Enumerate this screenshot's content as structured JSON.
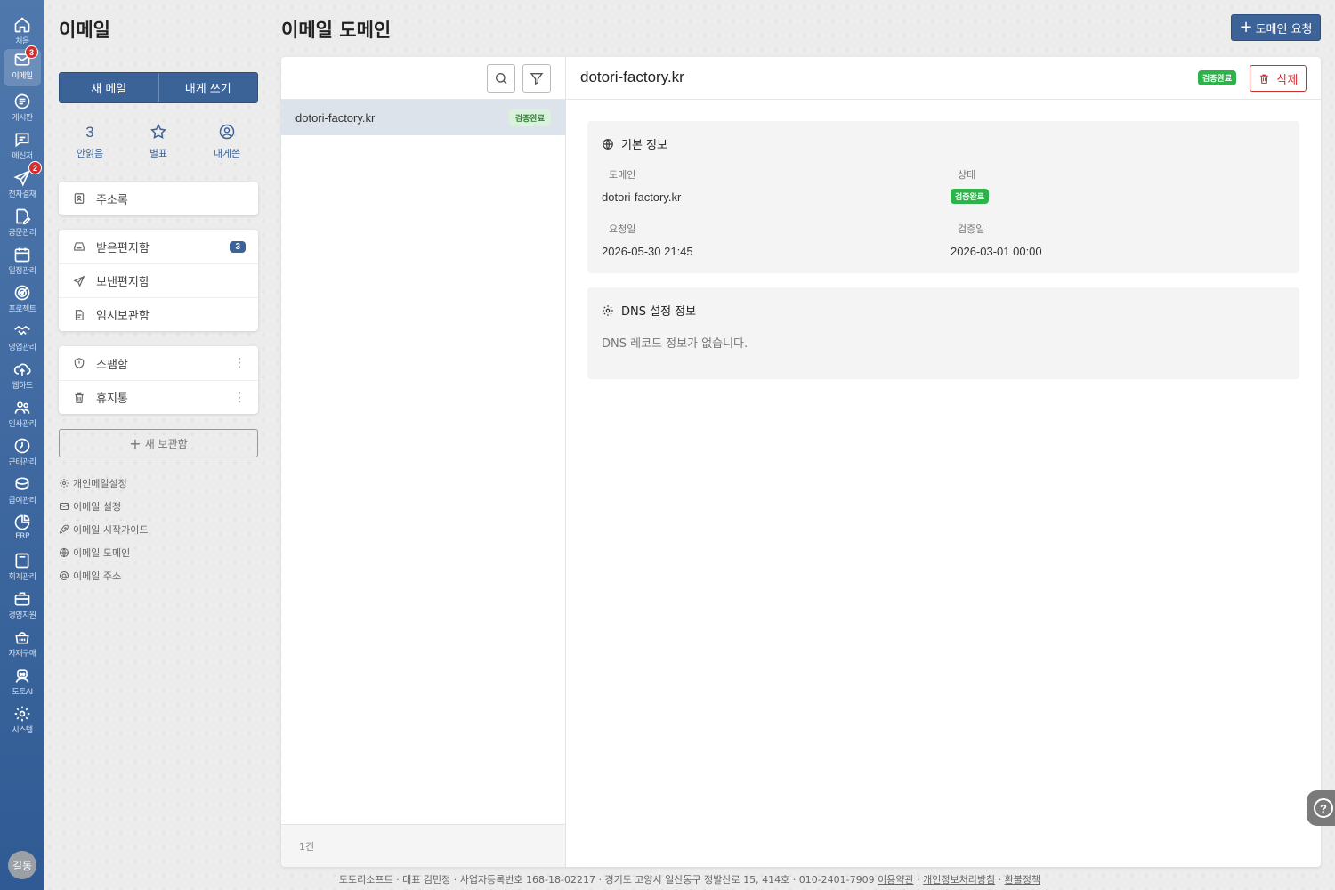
{
  "rail": {
    "items": [
      {
        "label": "처음",
        "icon": "home-icon"
      },
      {
        "label": "이메일",
        "icon": "mail-icon",
        "badge": "3"
      },
      {
        "label": "게시판",
        "icon": "board-icon"
      },
      {
        "label": "메신저",
        "icon": "chat-icon"
      },
      {
        "label": "전자결재",
        "icon": "send-icon",
        "badge": "2"
      },
      {
        "label": "공문관리",
        "icon": "document-edit-icon"
      },
      {
        "label": "일정관리",
        "icon": "calendar-icon"
      },
      {
        "label": "프로젝트",
        "icon": "target-icon"
      },
      {
        "label": "영업관리",
        "icon": "handshake-icon"
      },
      {
        "label": "웹하드",
        "icon": "cloud-upload-icon"
      },
      {
        "label": "인사관리",
        "icon": "people-icon"
      },
      {
        "label": "근태관리",
        "icon": "clock-icon"
      },
      {
        "label": "급여관리",
        "icon": "coins-icon"
      },
      {
        "label": "ERP",
        "icon": "pie-chart-icon"
      },
      {
        "label": "회계관리",
        "icon": "calculator-icon"
      },
      {
        "label": "경영지원",
        "icon": "briefcase-icon"
      },
      {
        "label": "자재구매",
        "icon": "basket-icon"
      },
      {
        "label": "도토AI",
        "icon": "robot-icon"
      },
      {
        "label": "시스템",
        "icon": "gear-icon"
      }
    ],
    "avatar": "길동"
  },
  "sidebar": {
    "title": "이메일",
    "new_mail": "새 메일",
    "self_mail": "내게 쓰기",
    "quick": {
      "unread_count": "3",
      "unread_label": "안읽음",
      "star_label": "별표",
      "self_label": "내게쓴"
    },
    "address_book": "주소록",
    "folders": [
      {
        "label": "받은편지함",
        "count": "3"
      },
      {
        "label": "보낸편지함"
      },
      {
        "label": "임시보관함"
      }
    ],
    "special": [
      {
        "label": "스팸함"
      },
      {
        "label": "휴지통"
      }
    ],
    "new_box": "새 보관함",
    "links": [
      {
        "label": "개인메일설정",
        "icon": "gear-icon"
      },
      {
        "label": "이메일 설정",
        "icon": "mail-icon"
      },
      {
        "label": "이메일 시작가이드",
        "icon": "rocket-icon"
      },
      {
        "label": "이메일 도메인",
        "icon": "globe-icon"
      },
      {
        "label": "이메일 주소",
        "icon": "at-icon"
      }
    ]
  },
  "main": {
    "title": "이메일 도메인",
    "request_button": "도메인 요청",
    "list": {
      "items": [
        {
          "domain": "dotori-factory.kr",
          "status": "검증완료"
        }
      ],
      "count_text": "1건"
    },
    "detail": {
      "title": "dotori-factory.kr",
      "status": "검증완료",
      "delete_label": "삭제",
      "basic": {
        "heading": "기본 정보",
        "domain_label": "도메인",
        "domain_value": "dotori-factory.kr",
        "status_label": "상태",
        "status_value": "검증완료",
        "requested_label": "요청일",
        "requested_value": "2026-05-30 21:45",
        "verified_label": "검증일",
        "verified_value": "2026-03-01 00:00"
      },
      "dns": {
        "heading": "DNS 설정 정보",
        "empty": "DNS 레코드 정보가 없습니다."
      }
    }
  },
  "footer": {
    "text": "도토리소프트 · 대표 김민정 · 사업자등록번호 168-18-02217 · 경기도 고양시 일산동구 정발산로 15, 414호 · 010-2401-7909",
    "terms": "이용약관",
    "privacy": "개인정보처리방침",
    "refund": "환불정책"
  },
  "colors": {
    "primary": "#3c6398",
    "success": "#2db34a",
    "danger": "#d32f2f",
    "rail_top": "#4f78ad",
    "rail_bottom": "#2f5a93"
  }
}
